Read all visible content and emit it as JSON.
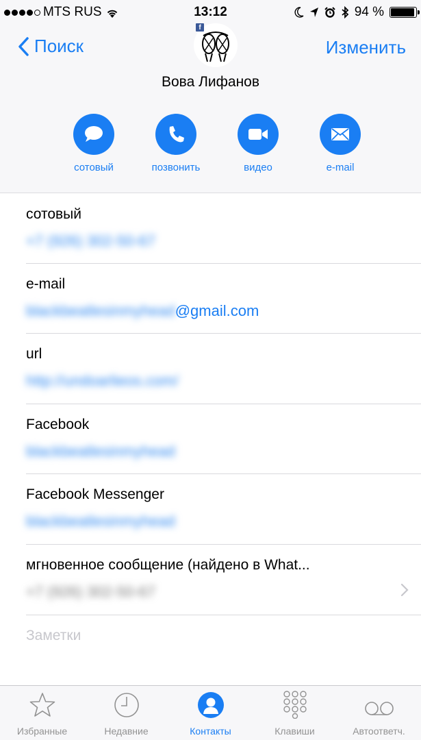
{
  "status_bar": {
    "carrier": "MTS RUS",
    "time": "13:12",
    "battery_text": "94 %",
    "battery_level": 0.94,
    "signal_dots_filled": 4
  },
  "nav": {
    "back_label": "Поиск",
    "edit_label": "Изменить"
  },
  "contact": {
    "name": "Вова Лифанов",
    "avatar_badge": "f"
  },
  "actions": [
    {
      "label": "сотовый",
      "icon": "message-icon"
    },
    {
      "label": "позвонить",
      "icon": "phone-icon"
    },
    {
      "label": "видео",
      "icon": "video-icon"
    },
    {
      "label": "e-mail",
      "icon": "mail-icon"
    }
  ],
  "details": [
    {
      "label": "сотовый",
      "value": "+7 (926) 302-50-67",
      "value_visible": ""
    },
    {
      "label": "e-mail",
      "value": "blackbeatlesinmyhead",
      "value_visible": "@gmail.com"
    },
    {
      "label": "url",
      "value": "http://undoarlieos.com/",
      "value_visible": ""
    },
    {
      "label": "Facebook",
      "value": "blackbeatlesinmyhead",
      "value_visible": ""
    },
    {
      "label": "Facebook Messenger",
      "value": "blackbeatlesinmyhead",
      "value_visible": ""
    },
    {
      "label": "мгновенное сообщение (найдено в What...",
      "value": "+7 (926) 302-50-67",
      "value_visible": ""
    }
  ],
  "notes_label": "Заметки",
  "colors": {
    "accent": "#1a7ef3",
    "header_bg": "#f7f7f9",
    "separator": "#d9d9dd",
    "tab_inactive": "#929292"
  },
  "tabbar": [
    {
      "label": "Избранные",
      "icon": "star-icon",
      "active": false
    },
    {
      "label": "Недавние",
      "icon": "clock-icon",
      "active": false
    },
    {
      "label": "Контакты",
      "icon": "person-icon",
      "active": true
    },
    {
      "label": "Клавиши",
      "icon": "keypad-icon",
      "active": false
    },
    {
      "label": "Автоответч.",
      "icon": "voicemail-icon",
      "active": false
    }
  ]
}
